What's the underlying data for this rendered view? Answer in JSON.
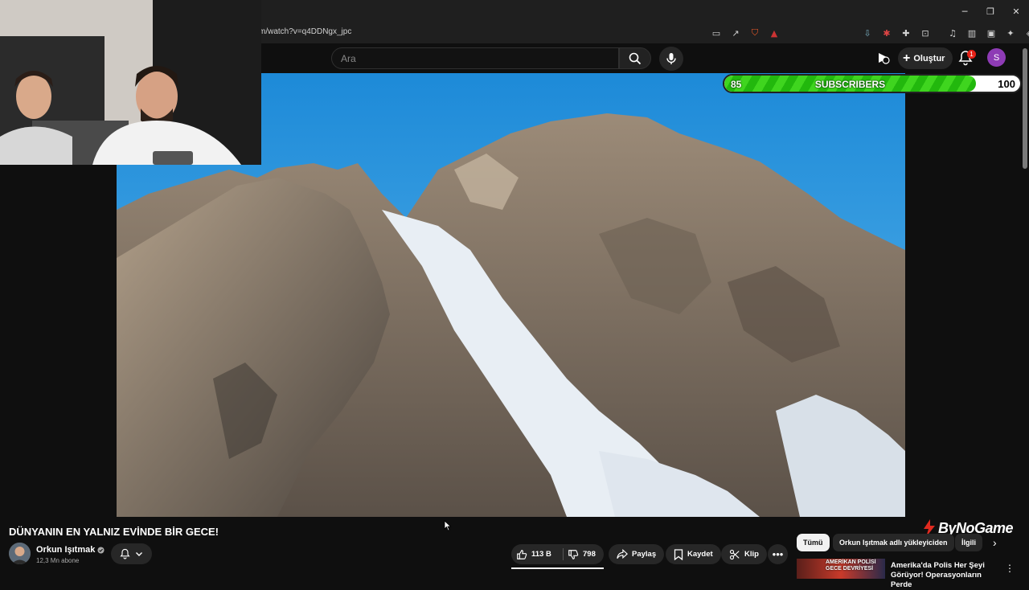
{
  "browser": {
    "url": "m/watch?v=q4DDNgx_jpc",
    "window_controls": [
      "─",
      "❐",
      "✕"
    ]
  },
  "header": {
    "search_placeholder": "Ara",
    "create_label": "Oluştur",
    "notification_count": "1",
    "account_initial": "S"
  },
  "overlay": {
    "subscribers_label": "SUBSCRIBERS",
    "current": "85",
    "goal": "100",
    "progress_fraction": 0.85
  },
  "video": {
    "title": "DÜNYANIN EN YALNIZ EVİNDE BİR GECE!"
  },
  "channel": {
    "name": "Orkun Işıtmak",
    "subscribers": "12,3 Mn abone"
  },
  "actions": {
    "likes": "113 B",
    "dislikes": "798",
    "share": "Paylaş",
    "save": "Kaydet",
    "clip": "Klip"
  },
  "chips": [
    {
      "label": "Tümü"
    },
    {
      "label": "Orkun Işıtmak adlı yükleyiciden"
    },
    {
      "label": "İlgili"
    }
  ],
  "watermark": "ByNoGame",
  "recommendation": {
    "thumb_text": "AMERİKAN POLİSİ GECE DEVRİYESİ",
    "title": "Amerika'da Polis Her Şeyi Görüyor! Operasyonların Perde"
  },
  "colors": {
    "accent_red": "#e62117",
    "progress_green": "#3fd51f",
    "avatar_purple": "#8e3bb5"
  }
}
